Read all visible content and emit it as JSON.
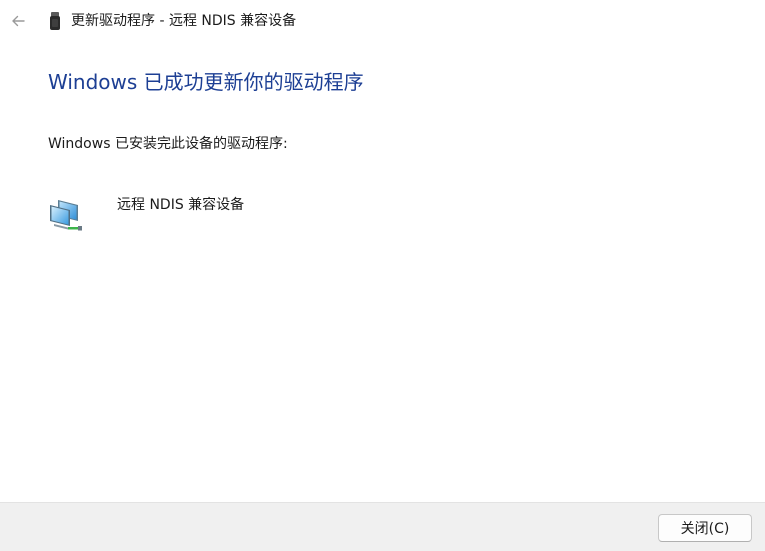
{
  "window": {
    "title": "更新驱动程序 - 远程 NDIS 兼容设备"
  },
  "main": {
    "heading": "Windows 已成功更新你的驱动程序",
    "description": "Windows 已安装完此设备的驱动程序:",
    "device_name": "远程 NDIS 兼容设备"
  },
  "footer": {
    "close_label": "关闭(C)"
  },
  "icons": {
    "back": "back-arrow-icon",
    "title": "usb-device-icon",
    "device": "network-adapter-icon"
  },
  "colors": {
    "heading": "#1d3f94",
    "footer_bg": "#f0f0f0"
  }
}
